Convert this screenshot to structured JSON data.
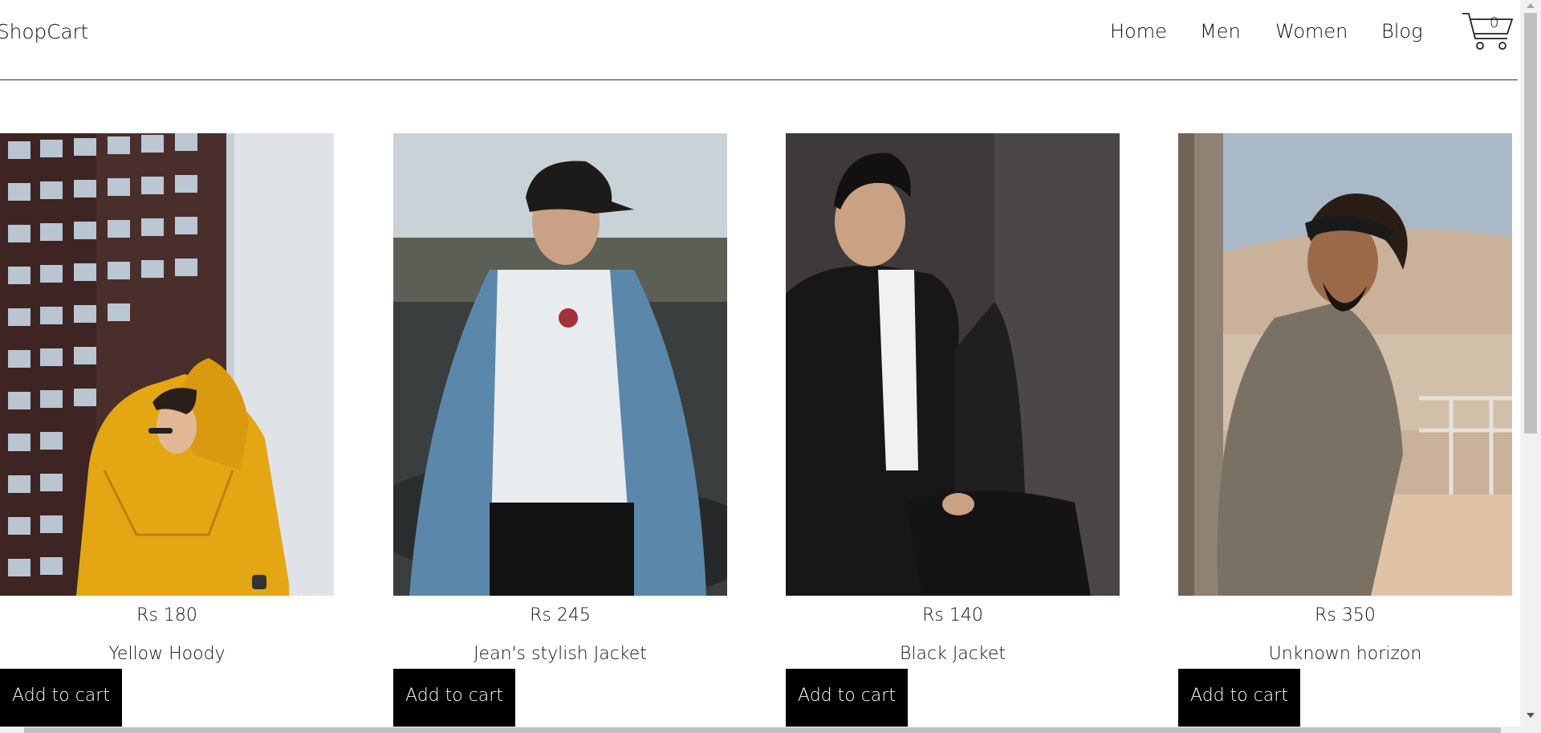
{
  "header": {
    "brand": "ShopCart",
    "nav": [
      "Home",
      "Men",
      "Women",
      "Blog"
    ],
    "cart_count": "0"
  },
  "products": [
    {
      "price": "Rs 180",
      "title": "Yellow Hoody",
      "button": "Add to cart"
    },
    {
      "price": "Rs 245",
      "title": "Jean's stylish Jacket",
      "button": "Add to cart"
    },
    {
      "price": "Rs 140",
      "title": "Black Jacket",
      "button": "Add to cart"
    },
    {
      "price": "Rs 350",
      "title": "Unknown horizon",
      "button": "Add to cart"
    }
  ],
  "colors": {
    "button_bg": "#000000",
    "button_text": "#ffffff",
    "header_rule": "#333333"
  }
}
